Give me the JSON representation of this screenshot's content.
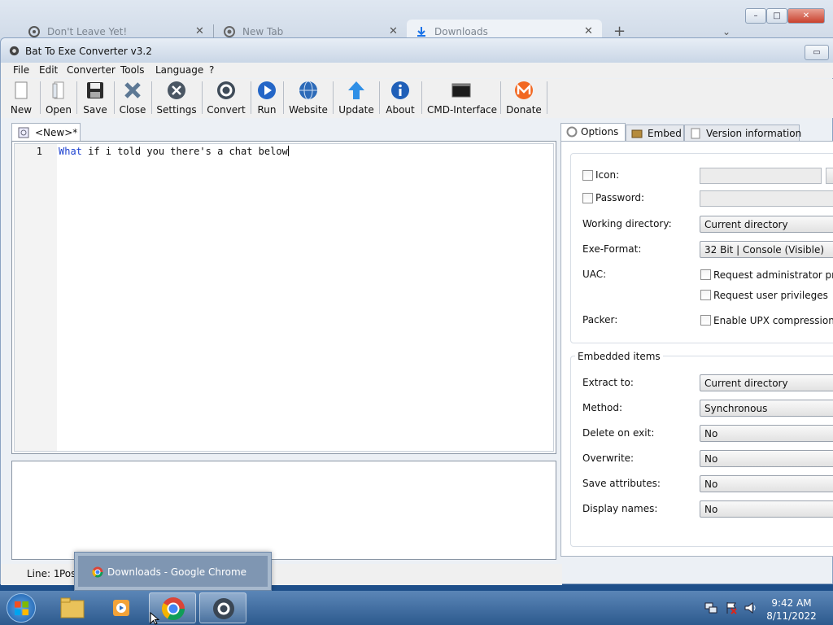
{
  "browser": {
    "tabs": [
      {
        "label": "Don't Leave Yet!"
      },
      {
        "label": "New Tab"
      },
      {
        "label": "Downloads"
      }
    ],
    "new_tab_glyph": "+",
    "window_buttons": {
      "minimize": "–",
      "restore": "□",
      "close": "✕"
    },
    "colors": {
      "accent": "#1a73e8"
    }
  },
  "app": {
    "title": "Bat To Exe Converter v3.2",
    "menu": [
      "File",
      "Edit",
      "Converter",
      "Tools",
      "Language",
      "?"
    ],
    "toolbar": [
      {
        "label": "New",
        "icon": "new-file-icon"
      },
      {
        "label": "Open",
        "icon": "open-file-icon"
      },
      {
        "label": "Save",
        "icon": "save-icon"
      },
      {
        "label": "Close",
        "icon": "close-file-icon"
      },
      {
        "label": "Settings",
        "icon": "settings-icon"
      },
      {
        "label": "Convert",
        "icon": "gear-icon"
      },
      {
        "label": "Run",
        "icon": "play-icon"
      },
      {
        "label": "Website",
        "icon": "globe-icon"
      },
      {
        "label": "Update",
        "icon": "arrow-up-icon"
      },
      {
        "label": "About",
        "icon": "info-icon"
      },
      {
        "label": "CMD-Interface",
        "icon": "console-icon"
      },
      {
        "label": "Donate",
        "icon": "monero-icon"
      }
    ],
    "editor": {
      "tab_label": "<New>*",
      "line_number": "1",
      "code_keyword": "What",
      "code_rest": " if i told you there's a chat below"
    },
    "status": {
      "line": "Line: 1",
      "pos": "Pos"
    },
    "options": {
      "tabs": [
        "Options",
        "Embed",
        "Version information"
      ],
      "icon_label": "Icon:",
      "password_label": "Password:",
      "working_dir_label": "Working directory:",
      "working_dir_value": "Current directory",
      "exe_format_label": "Exe-Format:",
      "exe_format_value": "32 Bit | Console (Visible)",
      "uac_label": "UAC:",
      "uac_admin": "Request administrator privi",
      "uac_user": "Request user privileges",
      "packer_label": "Packer:",
      "packer_upx": "Enable UPX compression",
      "embedded_title": "Embedded items",
      "extract_label": "Extract to:",
      "extract_value": "Current directory",
      "method_label": "Method:",
      "method_value": "Synchronous",
      "delete_label": "Delete on exit:",
      "delete_value": "No",
      "overwrite_label": "Overwrite:",
      "overwrite_value": "No",
      "saveattr_label": "Save attributes:",
      "saveattr_value": "No",
      "displaynames_label": "Display names:",
      "displaynames_value": "No"
    }
  },
  "taskbar": {
    "popup_label": "Downloads - Google Chrome",
    "time": "9:42 AM",
    "date": "8/11/2022"
  }
}
